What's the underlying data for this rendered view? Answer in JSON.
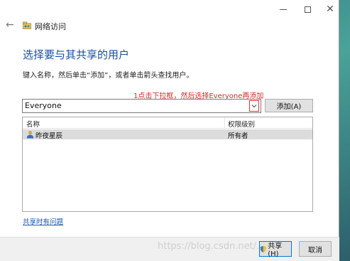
{
  "window": {
    "title": "网络访问",
    "controls": {
      "minimize": "minimize",
      "maximize": "maximize",
      "close": "✕"
    }
  },
  "nav": {
    "back_glyph": "←",
    "icon": "network-sharing-icon"
  },
  "main": {
    "heading": "选择要与其共享的用户",
    "description": "键入名称，然后单击“添加”，或者单击箭头查找用户。",
    "annotation": "1点击下拉框，然后选择Everyone再添加",
    "combo_value": "Everyone",
    "add_label": "添加(A)"
  },
  "table": {
    "headers": [
      "名称",
      "权限级别"
    ],
    "rows": [
      {
        "name": "昨夜星辰",
        "permission": "所有者",
        "icon": "user-icon"
      }
    ]
  },
  "help_link": "共享时有问题",
  "footer": {
    "share_label": "共享(H)",
    "cancel_label": "取消"
  },
  "watermark": "https://blog.csdn.net/..."
}
